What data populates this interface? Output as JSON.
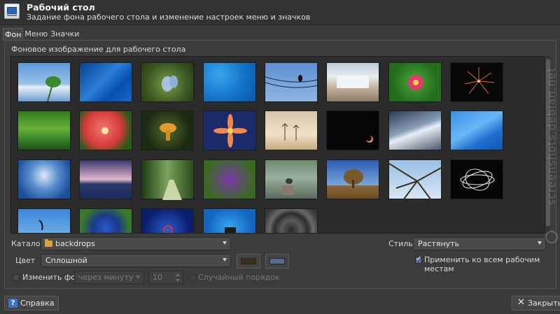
{
  "window": {
    "title": "Рабочий стол",
    "subtitle": "Задание фона рабочего стола и изменение настроек меню и значков"
  },
  "tabs": [
    {
      "label": "Фон",
      "active": true
    },
    {
      "label": "Меню",
      "active": false
    },
    {
      "label": "Значки",
      "active": false
    }
  ],
  "background": {
    "frame_label": "Фоновое изображение для рабочего стола",
    "thumbnails": [
      {
        "name": "sky-leaf"
      },
      {
        "name": "blue-abstract"
      },
      {
        "name": "butterfly"
      },
      {
        "name": "blue-gradient"
      },
      {
        "name": "bird-on-wire"
      },
      {
        "name": "waterfall"
      },
      {
        "name": "pink-flower"
      },
      {
        "name": "fireworks"
      },
      {
        "name": "green-forest-pond"
      },
      {
        "name": "red-lily"
      },
      {
        "name": "orange-mushroom"
      },
      {
        "name": "orange-lily-blue"
      },
      {
        "name": "misty-trees"
      },
      {
        "name": "night-moon"
      },
      {
        "name": "cloud-sunbeams"
      },
      {
        "name": "blue-waves"
      },
      {
        "name": "blue-horizon"
      },
      {
        "name": "lake-sunset"
      },
      {
        "name": "forest-path"
      },
      {
        "name": "purple-flowers"
      },
      {
        "name": "lake-bird"
      },
      {
        "name": "lone-tree"
      },
      {
        "name": "tree-branches"
      },
      {
        "name": "white-swirl"
      },
      {
        "name": "island-silhouette"
      },
      {
        "name": "blue-flowers"
      },
      {
        "name": "debian-swirl-blue"
      },
      {
        "name": "cow-blue"
      },
      {
        "name": "dark-ripples"
      }
    ]
  },
  "catalog": {
    "label": "Каталог",
    "value": "backdrops"
  },
  "style": {
    "label": "Стиль:",
    "value": "Растянуть"
  },
  "color": {
    "label": "Цвет",
    "value": "Сплошной",
    "primary_color": "#3b2f1e",
    "secondary_color": "#5c6c8e"
  },
  "apply_all": {
    "label": "Применить ко всем рабочим местам",
    "checked": true
  },
  "change_bg": {
    "label": "Изменить фон",
    "checked": false,
    "interval_placeholder": "через минуту",
    "interval_value": "10"
  },
  "random_order": {
    "label": "Случайный порядок",
    "checked": false
  },
  "footer": {
    "help_label": "Справка",
    "close_label": "Закрыть"
  },
  "watermark": {
    "text": "screenshots.debian.net"
  }
}
